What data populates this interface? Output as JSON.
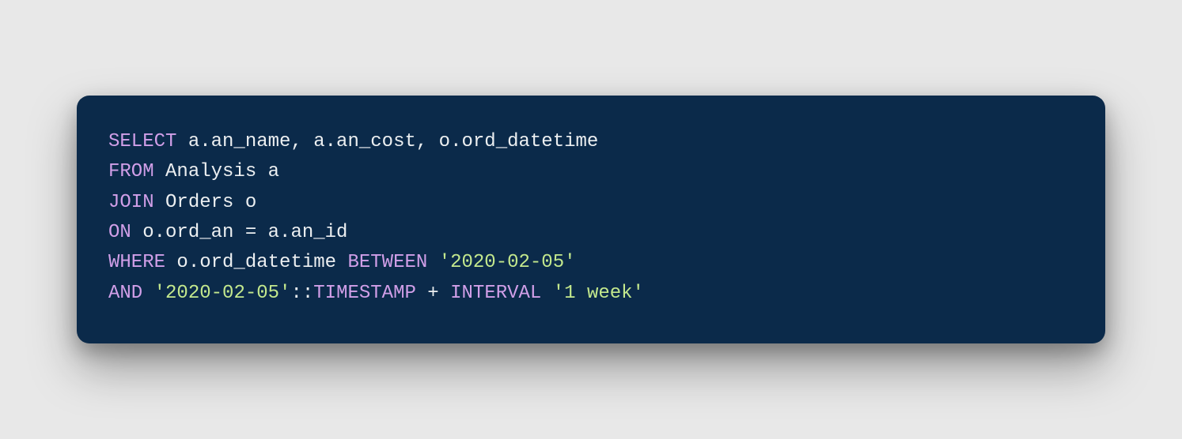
{
  "code": {
    "line1": {
      "kw_select": "SELECT",
      "rest": " a.an_name, a.an_cost, o.ord_datetime"
    },
    "line2": {
      "kw_from": "FROM",
      "rest": " Analysis a"
    },
    "line3": {
      "kw_join": "JOIN",
      "rest": " Orders o"
    },
    "line4": {
      "kw_on": "ON",
      "rest": " o.ord_an = a.an_id"
    },
    "line5": {
      "kw_where": "WHERE",
      "mid": " o.ord_datetime ",
      "kw_between": "BETWEEN",
      "sp": " ",
      "str1": "'2020-02-05'"
    },
    "line6": {
      "kw_and": "AND",
      "sp1": " ",
      "str1": "'2020-02-05'",
      "cast": "::",
      "type": "TIMESTAMP",
      "plus": " + ",
      "kw_interval": "INTERVAL",
      "sp2": " ",
      "str2": "'1 week'"
    }
  }
}
